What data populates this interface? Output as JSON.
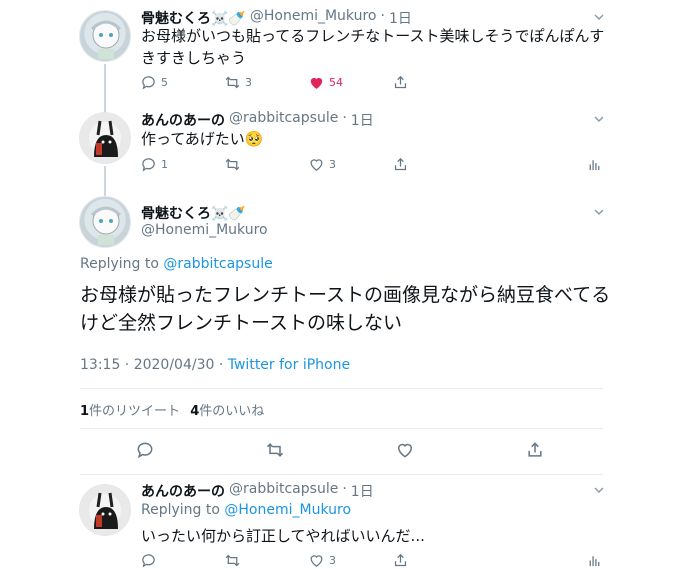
{
  "tweets": [
    {
      "name": "骨魅むくろ☠️🍼",
      "handle": "@Honemi_Mukuro",
      "time": "1日",
      "text": "お母様がいつも貼ってるフレンチなトースト美味しそうでぽんぽんすきすきしちゃう",
      "replies": "5",
      "retweets": "3",
      "likes": "54"
    },
    {
      "name": "あんのあーの",
      "handle": "@rabbitcapsule",
      "time": "1日",
      "text": "作ってあげたい🥺",
      "replies": "1",
      "retweets": "",
      "likes": "3"
    }
  ],
  "main": {
    "name": "骨魅むくろ☠️🍼",
    "handle": "@Honemi_Mukuro",
    "replying_prefix": "Replying to ",
    "replying_handle": "@rabbitcapsule",
    "text": "お母様が貼ったフレンチトーストの画像見ながら納豆食べてるけど全然フレンチトーストの味しない",
    "datetime": "13:15 · 2020/04/30 · ",
    "source": "Twitter for iPhone",
    "retweet_count": "1",
    "retweet_label": "件のリツイート",
    "like_count": "4",
    "like_label": "件のいいね"
  },
  "reply": {
    "name": "あんのあーの",
    "handle": "@rabbitcapsule",
    "time": "1日",
    "replying_prefix": "Replying to ",
    "replying_handle": "@Honemi_Mukuro",
    "text": "いったい何から訂正してやればいいんだ...",
    "replies": "",
    "retweets": "",
    "likes": "3"
  },
  "colors": {
    "like_red": "#e0245e",
    "link_blue": "#1b95e0",
    "gray": "#657786"
  }
}
